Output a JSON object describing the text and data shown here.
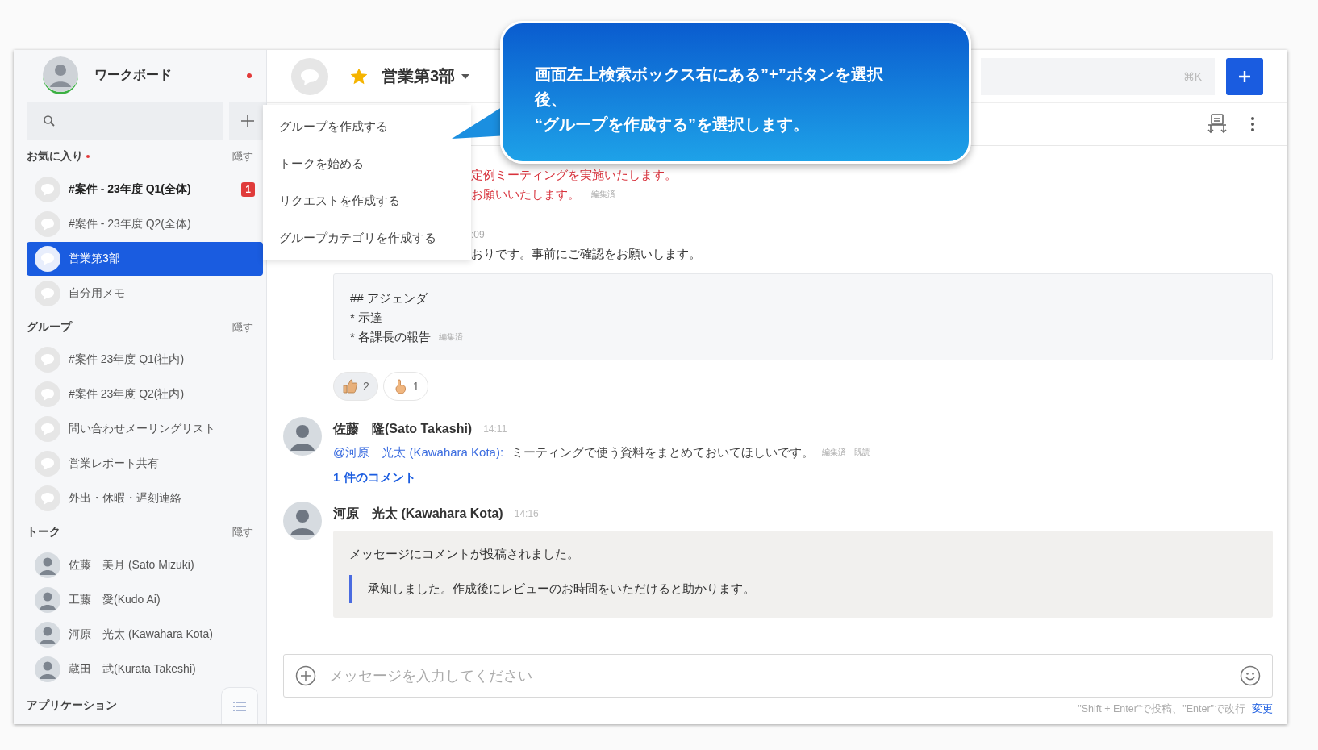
{
  "callout": {
    "lines": [
      "画面左上検索ボックス右にある”+”ボタンを選択",
      "後、",
      "“グループを作成する”を選択します。"
    ]
  },
  "sidebar": {
    "workspace": "ワークボード",
    "unread": true,
    "sections": [
      {
        "title": "お気に入り",
        "unread": true,
        "action": "隠す",
        "items": [
          {
            "kind": "group",
            "label": "#案件 - 23年度 Q1(全体)",
            "unread": true,
            "badge": "1",
            "selected": false
          },
          {
            "kind": "group",
            "label": "#案件 - 23年度 Q2(全体)",
            "unread": false,
            "selected": false
          },
          {
            "kind": "group",
            "label": "営業第3部",
            "unread": false,
            "selected": true
          },
          {
            "kind": "group",
            "label": "自分用メモ",
            "unread": false,
            "selected": false
          }
        ]
      },
      {
        "title": "グループ",
        "unread": false,
        "action": "隠す",
        "items": [
          {
            "kind": "group",
            "label": "#案件 23年度 Q1(社内)",
            "unread": false,
            "selected": false
          },
          {
            "kind": "group",
            "label": "#案件 23年度 Q2(社内)",
            "unread": false,
            "selected": false
          },
          {
            "kind": "group",
            "label": "問い合わせメーリングリスト",
            "unread": false,
            "selected": false
          },
          {
            "kind": "group",
            "label": "営業レポート共有",
            "unread": false,
            "selected": false
          },
          {
            "kind": "group",
            "label": "外出・休暇・遅刻連絡",
            "unread": false,
            "selected": false
          }
        ]
      },
      {
        "title": "トーク",
        "unread": false,
        "action": "隠す",
        "items": [
          {
            "kind": "person",
            "label": "佐藤　美月 (Sato Mizuki)",
            "unread": false,
            "selected": false
          },
          {
            "kind": "person",
            "label": "工藤　愛(Kudo Ai)",
            "unread": false,
            "selected": false
          },
          {
            "kind": "person",
            "label": "河原　光太 (Kawahara Kota)",
            "unread": false,
            "selected": false
          },
          {
            "kind": "person",
            "label": "蔵田　武(Kurata Takeshi)",
            "unread": false,
            "selected": false
          }
        ]
      }
    ],
    "footer_section": "アプリケーション"
  },
  "dropdown_menu": [
    "グループを作成する",
    "トークを始める",
    "リクエストを作成する",
    "グループカテゴリを作成する"
  ],
  "header": {
    "title": "営業第3部",
    "starred": true,
    "search_shortcut": "⌘K"
  },
  "fragments": [
    {
      "kind": "alert",
      "text": "定例ミーティングを実施いたします。"
    },
    {
      "kind": "alert",
      "text": "お願いいたします。",
      "note": "編集済"
    },
    {
      "kind": "time",
      "text": ":09"
    },
    {
      "kind": "plain",
      "text": "おりです。事前にご確認をお願いします。"
    }
  ],
  "agenda": {
    "lines": [
      "## アジェンダ",
      "* 示達",
      "* 各課長の報告"
    ],
    "note": "編集済"
  },
  "reactions": [
    {
      "kind": "thumbs",
      "count": "2",
      "selected": true
    },
    {
      "kind": "hand",
      "count": "1",
      "selected": false
    }
  ],
  "messages": [
    {
      "author": "佐藤　隆(Sato Takashi)",
      "time": "14:11",
      "mention": "@河原　光太 (Kawahara Kota):",
      "text": "ミーティングで使う資料をまとめておいてほしいです。",
      "notes": [
        "編集済",
        "既読"
      ],
      "comments": "1 件のコメント"
    },
    {
      "author": "河原　光太 (Kawahara Kota)",
      "time": "14:16",
      "notice": "メッセージにコメントが投稿されました。",
      "quote": "承知しました。作成後にレビューのお時間をいただけると助かります。"
    }
  ],
  "composer": {
    "placeholder": "メッセージを入力してください",
    "hint": "\"Shift + Enter\"で投稿、\"Enter\"で改行",
    "hint_link": "変更"
  }
}
